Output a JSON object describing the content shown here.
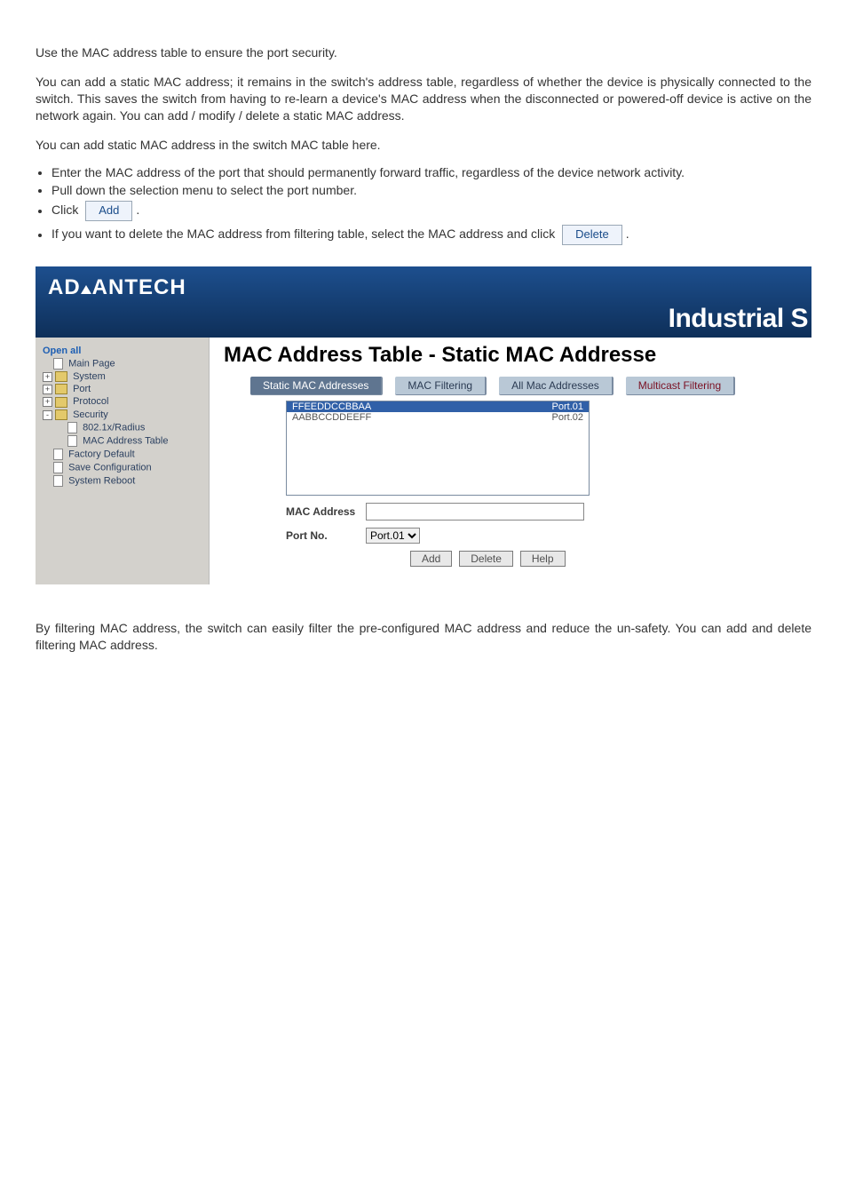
{
  "intro": {
    "p1": "Use the MAC address table to ensure the port security.",
    "p2": "You can add a static MAC address; it remains in the switch's address table, regardless of whether the device is physically connected to the switch. This saves the switch from having to re-learn a device's MAC address when the disconnected or powered-off device is active on the network again. You can add / modify / delete a static MAC address.",
    "p3": "You can add static MAC address in the switch MAC table here."
  },
  "bullets": {
    "b1": "Enter the MAC address of the port that should permanently forward traffic, regardless of the device network activity.",
    "b2": "Pull down the selection menu to select the port number.",
    "b3_prefix": "Click",
    "b3_btn": "Add",
    "b3_suffix": ".",
    "b4_prefix": "If you want to delete the MAC address from filtering table, select the MAC address and click",
    "b4_btn": "Delete",
    "b4_suffix": "."
  },
  "screenshot": {
    "brand": "ADVANTECH",
    "brand_a": "AD",
    "brand_b": "ANTECH",
    "slogan": "Industrial S",
    "sidebar": {
      "open_all": "Open all",
      "items": [
        {
          "label": "Main Page",
          "icon": "page",
          "indent": 1
        },
        {
          "label": "System",
          "icon": "folder",
          "plus": "+",
          "indent": 0
        },
        {
          "label": "Port",
          "icon": "folder",
          "plus": "+",
          "indent": 0
        },
        {
          "label": "Protocol",
          "icon": "folder",
          "plus": "+",
          "indent": 0
        },
        {
          "label": "Security",
          "icon": "folder",
          "plus": "-",
          "indent": 0
        },
        {
          "label": "802.1x/Radius",
          "icon": "page",
          "indent": 2
        },
        {
          "label": "MAC Address Table",
          "icon": "page",
          "indent": 2
        },
        {
          "label": "Factory Default",
          "icon": "page",
          "indent": 1
        },
        {
          "label": "Save Configuration",
          "icon": "page",
          "indent": 1
        },
        {
          "label": "System Reboot",
          "icon": "page",
          "indent": 1
        }
      ]
    },
    "main": {
      "title": "MAC Address Table - Static MAC Addresse",
      "tabs": [
        "Static MAC Addresses",
        "MAC Filtering",
        "All Mac Addresses",
        "Multicast Filtering"
      ],
      "active_tab": 0,
      "listbox": [
        {
          "mac": "FFEEDDCCBBAA",
          "port": "Port.01",
          "selected": true
        },
        {
          "mac": "AABBCCDDEEFF",
          "port": "Port.02",
          "selected": false
        }
      ],
      "form": {
        "mac_label": "MAC Address",
        "mac_value": "",
        "port_label": "Port No.",
        "port_value": "Port.01"
      },
      "buttons": {
        "add": "Add",
        "delete": "Delete",
        "help": "Help"
      }
    }
  },
  "outro": {
    "p1": "By filtering MAC address, the switch can easily filter the pre-configured MAC address and reduce the un-safety. You can add and delete filtering MAC address."
  }
}
